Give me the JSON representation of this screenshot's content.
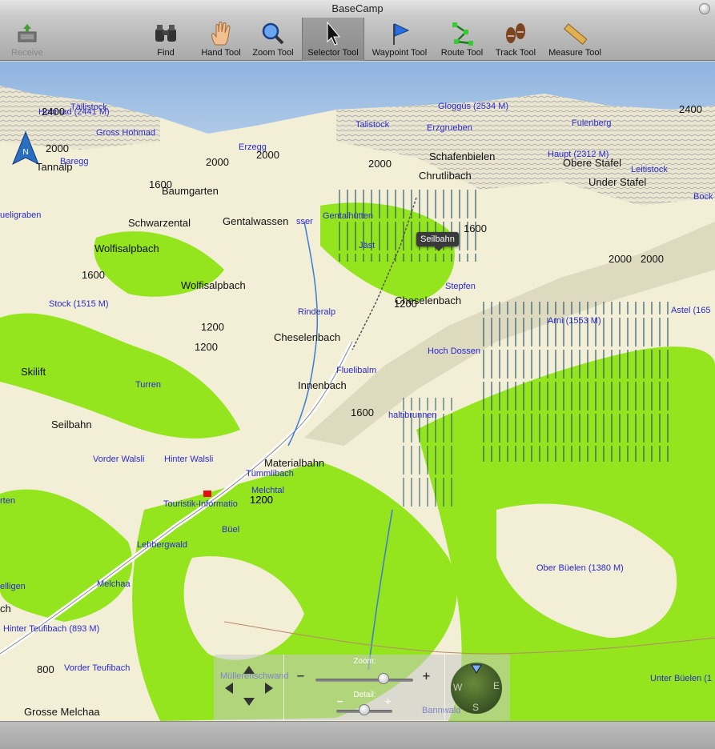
{
  "window": {
    "title": "BaseCamp"
  },
  "toolbar": {
    "receive": "Receive",
    "find": "Find",
    "hand": "Hand Tool",
    "zoom": "Zoom Tool",
    "selector": "Selector Tool",
    "waypoint": "Waypoint Tool",
    "route": "Route Tool",
    "track": "Track Tool",
    "measure": "Measure Tool"
  },
  "map": {
    "north": "N",
    "tooltip": "Seilbahn",
    "labels_blue": [
      "Tällistock",
      "Hohmad (2441 M)",
      "Gross Hohmad",
      "Baregg",
      "Erzegg",
      "Talistock",
      "Gloggüs (2534 M)",
      "Erzgrueben",
      "Fulenberg",
      "Haupt (2312 M)",
      "Leitistock",
      "Bock",
      "Gentalhütten",
      "Jäst",
      "Stepfen",
      "Astel (165",
      "Arni (1553 M)",
      "Rinderalp",
      "Stock (1515 M)",
      "Hoch Dossen",
      "Fluelibalm",
      "Turren",
      "Vorder Walsli",
      "Hinter Walsli",
      "Tümmlibach",
      "Melchtal",
      "Touristik-Informatio",
      "Büel",
      "Lehbergwald",
      "Melchaa",
      "Hinter Teufibach (893 M)",
      "Vorder Teufibach",
      "Müllerenschwand",
      "Bannwald",
      "Ober Büelen (1380 M)",
      "Unter Büelen (1",
      "ueligraben",
      "rten",
      "elligen",
      "haltibrunnen",
      "sser"
    ],
    "labels_black": [
      "Tannalp",
      "Baumgarten",
      "Schwarzental",
      "Gentalwassen",
      "Wolfisalpbach",
      "Wolfisalpbach",
      "Schafenbielen",
      "Chrutlibach",
      "Obere Stafel",
      "Under Stafel",
      "Cheselenbach",
      "Cheselenbach",
      "Innenbach",
      "Skilift",
      "Seilbahn",
      "Materialbahn",
      "Grosse Melchaa",
      "ch"
    ],
    "elevations": [
      "2400",
      "2000",
      "2000",
      "1600",
      "2000",
      "2000",
      "2000",
      "2400",
      "1600",
      "2000",
      "1600",
      "1200",
      "1200",
      "1200",
      "1200",
      "1600",
      "1200",
      "800"
    ]
  },
  "controls": {
    "zoom_label": "Zoom:",
    "detail_label": "Detail:",
    "zoom_level": 0.7,
    "detail_level": 0.5,
    "compass": {
      "w": "W",
      "e": "E",
      "s": "S"
    }
  },
  "colors": {
    "terrain": "#f2efd6",
    "vegetation": "#94e41e",
    "sky": "#a9c6e6",
    "road": "#ffffff",
    "water": "#3b7cd4",
    "contour": "#b9876f"
  }
}
